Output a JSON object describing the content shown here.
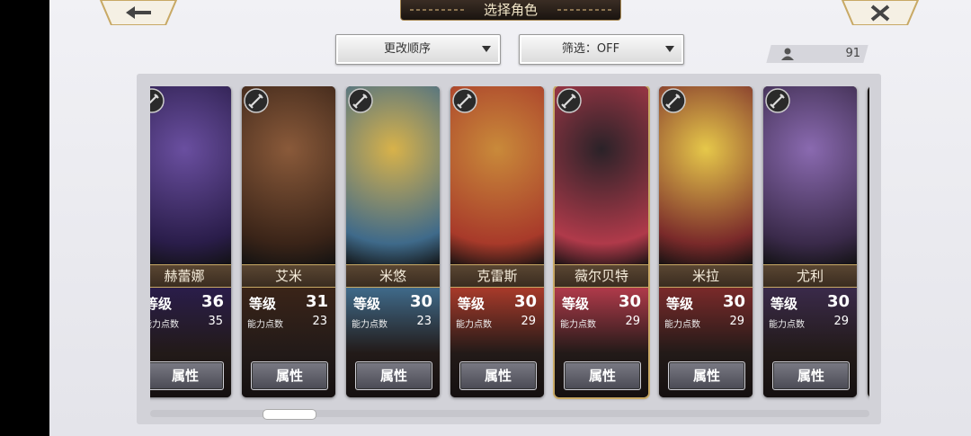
{
  "header": {
    "title": "选择角色",
    "back_icon": "back-arrow-icon",
    "close_icon": "close-icon"
  },
  "toolbar": {
    "sort_label": "更改顺序",
    "filter_label": "筛选：OFF"
  },
  "counter": {
    "icon": "user-icon",
    "value": "91"
  },
  "labels": {
    "level": "等级",
    "ability_points": "能力点数",
    "attributes_button": "属性"
  },
  "colors": {
    "accent_gold": "#c8a965",
    "nameplate": "#4a3828"
  },
  "characters": [
    {
      "name": "赫蕾娜",
      "level": "36",
      "ability_points": "35",
      "type_icon": "armor-icon",
      "selected": false
    },
    {
      "name": "艾米",
      "level": "31",
      "ability_points": "23",
      "type_icon": "gauntlet-icon",
      "selected": false
    },
    {
      "name": "米悠",
      "level": "30",
      "ability_points": "23",
      "type_icon": "sword-icon",
      "selected": false
    },
    {
      "name": "克雷斯",
      "level": "30",
      "ability_points": "29",
      "type_icon": "sword-icon",
      "selected": false
    },
    {
      "name": "薇尔贝特",
      "level": "30",
      "ability_points": "29",
      "type_icon": "sword-icon",
      "selected": true
    },
    {
      "name": "米拉",
      "level": "30",
      "ability_points": "29",
      "type_icon": "sword-icon",
      "selected": false
    },
    {
      "name": "尤利",
      "level": "30",
      "ability_points": "29",
      "type_icon": "katana-icon",
      "selected": false
    }
  ]
}
